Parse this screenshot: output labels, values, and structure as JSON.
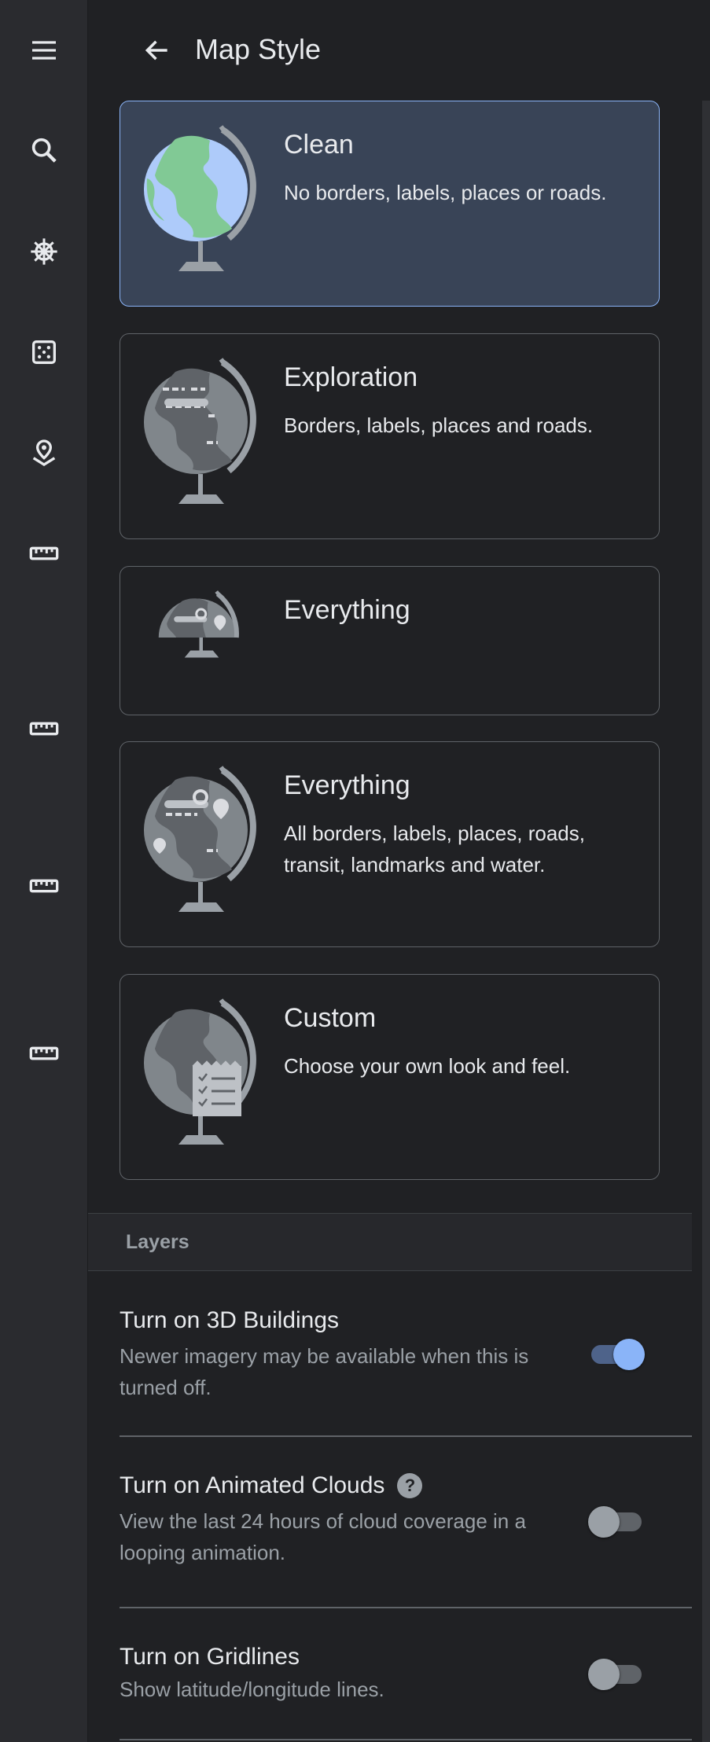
{
  "header": {
    "title": "Map Style"
  },
  "rail": {
    "icons": [
      "menu-icon",
      "search-icon",
      "ship-wheel-icon",
      "dice-icon",
      "map-pin-icon",
      "ruler-icon",
      "ruler-icon",
      "ruler-icon",
      "ruler-icon"
    ]
  },
  "styles": [
    {
      "title": "Clean",
      "description": "No borders, labels, places or roads.",
      "selected": true
    },
    {
      "title": "Exploration",
      "description": "Borders, labels, places and roads.",
      "selected": false
    },
    {
      "title": "Everything",
      "description": "",
      "selected": false
    },
    {
      "title": "Everything",
      "description": "All borders, labels, places, roads, transit, landmarks and water.",
      "selected": false
    },
    {
      "title": "Custom",
      "description": "Choose your own look and feel.",
      "selected": false
    }
  ],
  "layers": {
    "section_label": "Layers",
    "items": [
      {
        "title": "Turn on 3D Buildings",
        "description": "Newer imagery may be available when this is turned off.",
        "enabled": true
      },
      {
        "title": "Turn on Animated Clouds",
        "help": "?",
        "description": "View the last 24 hours of cloud coverage in a looping animation.",
        "enabled": false
      },
      {
        "title": "Turn on Gridlines",
        "description": "Show latitude/longitude lines.",
        "enabled": false
      }
    ]
  },
  "colors": {
    "accent": "#8ab4f8",
    "selected_bg": "#394457",
    "panel_bg": "#202124",
    "rail_bg": "#2a2b2f"
  }
}
